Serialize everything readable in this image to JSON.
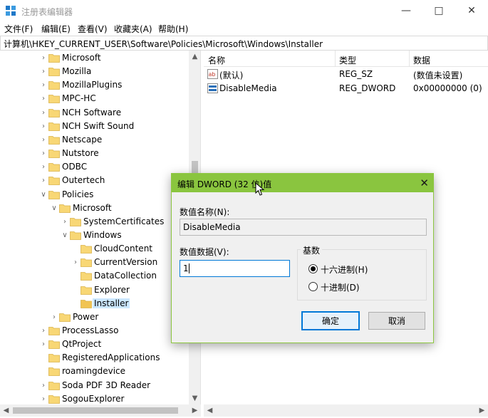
{
  "window": {
    "title": "注册表编辑器"
  },
  "menu": [
    "文件(F)",
    "编辑(E)",
    "查看(V)",
    "收藏夹(A)",
    "帮助(H)"
  ],
  "address": "计算机\\HKEY_CURRENT_USER\\Software\\Policies\\Microsoft\\Windows\\Installer",
  "tree": [
    {
      "label": "Microsoft",
      "expander": "collapsed",
      "level": 0
    },
    {
      "label": "Mozilla",
      "expander": "collapsed",
      "level": 0
    },
    {
      "label": "MozillaPlugins",
      "expander": "collapsed",
      "level": 0
    },
    {
      "label": "MPC-HC",
      "expander": "collapsed",
      "level": 0
    },
    {
      "label": "NCH Software",
      "expander": "collapsed",
      "level": 0
    },
    {
      "label": "NCH Swift Sound",
      "expander": "collapsed",
      "level": 0
    },
    {
      "label": "Netscape",
      "expander": "collapsed",
      "level": 0
    },
    {
      "label": "Nutstore",
      "expander": "collapsed",
      "level": 0
    },
    {
      "label": "ODBC",
      "expander": "collapsed",
      "level": 0
    },
    {
      "label": "Outertech",
      "expander": "collapsed",
      "level": 0
    },
    {
      "label": "Policies",
      "expander": "expanded",
      "level": 0
    },
    {
      "label": "Microsoft",
      "expander": "expanded",
      "level": 1
    },
    {
      "label": "SystemCertificates",
      "expander": "collapsed",
      "level": 2
    },
    {
      "label": "Windows",
      "expander": "expanded",
      "level": 2
    },
    {
      "label": "CloudContent",
      "expander": "none",
      "level": 3
    },
    {
      "label": "CurrentVersion",
      "expander": "collapsed",
      "level": 3
    },
    {
      "label": "DataCollection",
      "expander": "none",
      "level": 3
    },
    {
      "label": "Explorer",
      "expander": "none",
      "level": 3
    },
    {
      "label": "Installer",
      "expander": "none",
      "level": 3,
      "selected": true
    },
    {
      "label": "Power",
      "expander": "collapsed",
      "level": 1
    },
    {
      "label": "ProcessLasso",
      "expander": "collapsed",
      "level": 0
    },
    {
      "label": "QtProject",
      "expander": "collapsed",
      "level": 0
    },
    {
      "label": "RegisteredApplications",
      "expander": "none",
      "level": 0
    },
    {
      "label": "roamingdevice",
      "expander": "none",
      "level": 0
    },
    {
      "label": "Soda PDF 3D Reader",
      "expander": "collapsed",
      "level": 0
    },
    {
      "label": "SogouExplorer",
      "expander": "collapsed",
      "level": 0
    }
  ],
  "list": {
    "headers": {
      "name": "名称",
      "type": "类型",
      "data": "数据"
    },
    "rows": [
      {
        "icon": "string-value-icon",
        "name": "(默认)",
        "type": "REG_SZ",
        "data": "(数值未设置)"
      },
      {
        "icon": "dword-value-icon",
        "name": "DisableMedia",
        "type": "REG_DWORD",
        "data": "0x00000000 (0)"
      }
    ]
  },
  "dialog": {
    "title": "编辑 DWORD (32 位)值",
    "value_name_label": "数值名称(N):",
    "value_name": "DisableMedia",
    "value_data_label": "数值数据(V):",
    "value_data": "1",
    "base_label": "基数",
    "hex_label": "十六进制(H)",
    "dec_label": "十进制(D)",
    "selected_base": "hex",
    "ok_label": "确定",
    "cancel_label": "取消"
  },
  "colors": {
    "dialog_titlebar": "#8ac53f",
    "selection": "#cce8ff",
    "folder": "#f8d775",
    "accent": "#0078d7"
  }
}
